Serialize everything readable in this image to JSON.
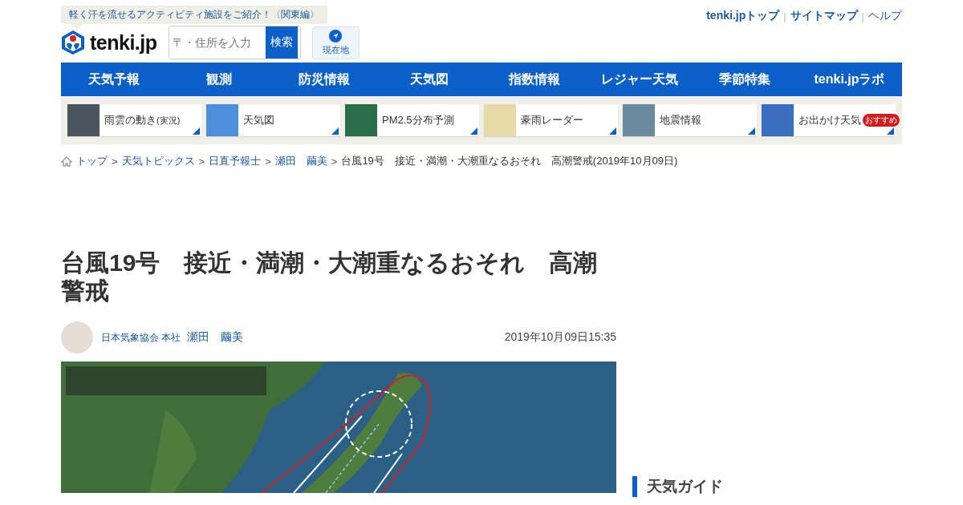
{
  "promo": {
    "text": "軽く汗を流せるアクティビティ施設をご紹介！〈関東編〉"
  },
  "logo": {
    "text": "tenki.jp"
  },
  "link_separator": "|",
  "breadcrumb_separator": ">",
  "top_links": [
    {
      "label": "tenki.jpトップ",
      "bold": true
    },
    {
      "label": "サイトマップ",
      "bold": true
    },
    {
      "label": "ヘルプ",
      "bold": false
    }
  ],
  "search": {
    "placeholder": "〒・住所を入力",
    "button": "検索"
  },
  "location_button": {
    "label": "現在地"
  },
  "nav": [
    "天気予報",
    "観測",
    "防災情報",
    "天気図",
    "指数情報",
    "レジャー天気",
    "季節特集",
    "tenki.jpラボ"
  ],
  "quick_links": [
    {
      "label": "雨雲の動き",
      "note": "(実況)"
    },
    {
      "label": "天気図"
    },
    {
      "label": "PM2.5分布予測"
    },
    {
      "label": "豪雨レーダー"
    },
    {
      "label": "地震情報"
    },
    {
      "label": "お出かけ天気",
      "badge": "おすすめ"
    }
  ],
  "breadcrumb": [
    {
      "label": "トップ",
      "link": true
    },
    {
      "label": "天気トピックス",
      "link": true
    },
    {
      "label": "日直予報士",
      "link": true
    },
    {
      "label": "瀬田　繭美",
      "link": true
    },
    {
      "label": "台風19号　接近・満潮・大潮重なるおそれ　高潮警戒(2019年10月09日)",
      "link": false
    }
  ],
  "article": {
    "title": "台風19号　接近・満潮・大潮重なるおそれ　高潮警戒",
    "author_org": "日本気象協会 本社",
    "author_name": "瀬田　繭美",
    "date": "2019年10月09日15:35"
  },
  "sidebar": {
    "heading": "天気ガイド"
  }
}
